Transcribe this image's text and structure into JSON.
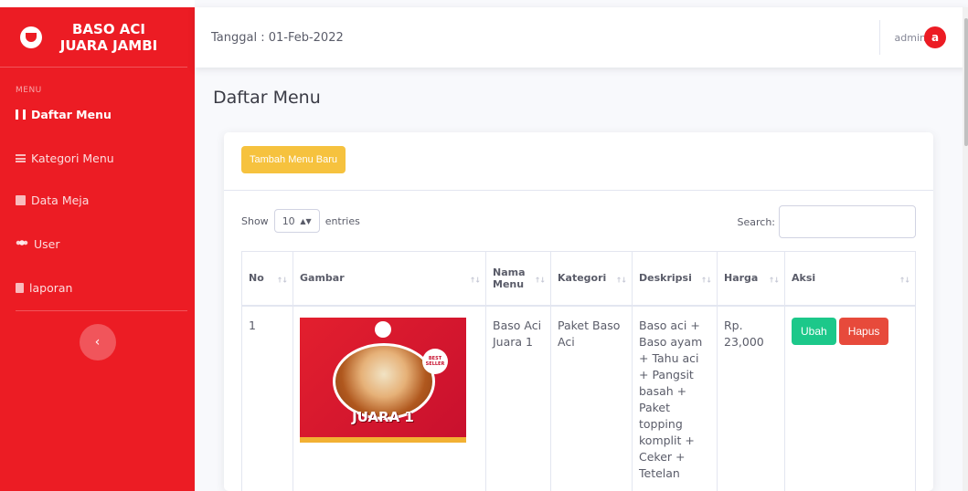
{
  "sidebar": {
    "brand": "BASO ACI\nJUARA JAMBI",
    "heading": "MENU",
    "items": [
      {
        "label": "Daftar Menu",
        "icon": "food-icon"
      },
      {
        "label": "Kategori Menu",
        "icon": "list-icon"
      },
      {
        "label": "Data Meja",
        "icon": "table-icon"
      },
      {
        "label": "User",
        "icon": "users-icon"
      },
      {
        "label": "laporan",
        "icon": "file-icon"
      }
    ],
    "toggle": "‹",
    "color": "#ec1c24"
  },
  "topbar": {
    "date": "Tanggal : 01-Feb-2022",
    "user": "admin",
    "avatar": "a"
  },
  "page": {
    "title": "Daftar Menu",
    "add_button": "Tambah Menu Baru"
  },
  "table_controls": {
    "show": "Show",
    "entries_value": "10",
    "entries": "entries",
    "search": "Search:"
  },
  "table": {
    "headers": [
      "No",
      "Gambar",
      "Nama Menu",
      "Kategori",
      "Deskripsi",
      "Harga",
      "Aksi"
    ],
    "rows": [
      {
        "no": "1",
        "image_caption": "JUARA 1",
        "image_badge": "BEST SELLER",
        "name": "Baso Aci Juara 1",
        "category": "Paket Baso Aci",
        "description": "Baso aci + Baso ayam + Tahu aci + Pangsit basah + Paket topping komplit + Ceker + Tetelan",
        "price": "Rp. 23,000",
        "edit": "Ubah",
        "delete": "Hapus"
      }
    ]
  }
}
